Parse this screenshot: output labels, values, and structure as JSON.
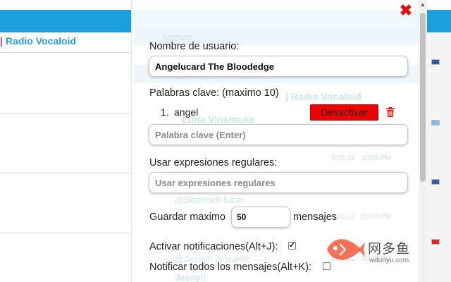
{
  "background": {
    "nav_link": "Radio Vocaloid"
  },
  "ghost": {
    "search_placeholder": "nombre",
    "link": "| Radio Vocaloid",
    "user1": "Luna Vinsmoke",
    "user2": "@Bertholdt fubar",
    "user3": "@Jessy!! in bueno",
    "user4": "Jessy!!",
    "time1": "8:05 12 - 10:05 PM",
    "time2": "8:05 12 - 10:05 PM",
    "time3": "8:05 12 - 10:05 PM"
  },
  "popup": {
    "username_label": "Nombre de usuario:",
    "username_value": "Angelucard The Bloodedge",
    "keywords_label": "Palabras clave: (maximo 10)",
    "keywords": [
      {
        "number": "1.",
        "text": "angel",
        "button": "Desactivar"
      }
    ],
    "keyword_placeholder": "Palabra clave (Enter)",
    "regex_label": "Usar expresiones regulares:",
    "regex_placeholder": "Usar expresiones regulares",
    "save_max_label": "Guardar maximo",
    "save_max_value": "50",
    "save_max_suffix": "mensajes",
    "notifications_label": "Activar notificaciones(Alt+J):",
    "notifications_checked": true,
    "notify_all_label": "Notificar todos los mensajes(Alt+K):",
    "notify_all_checked": false
  },
  "watermark": {
    "name": "网多鱼",
    "url": "wduoyu.com"
  },
  "colors": {
    "topbar": "#1ba0db",
    "deactivate": "#f00000",
    "close": "#e01010"
  },
  "icons": [
    "close-icon",
    "trash-icon",
    "scroll-up-icon",
    "watermark-fish-logo"
  ]
}
